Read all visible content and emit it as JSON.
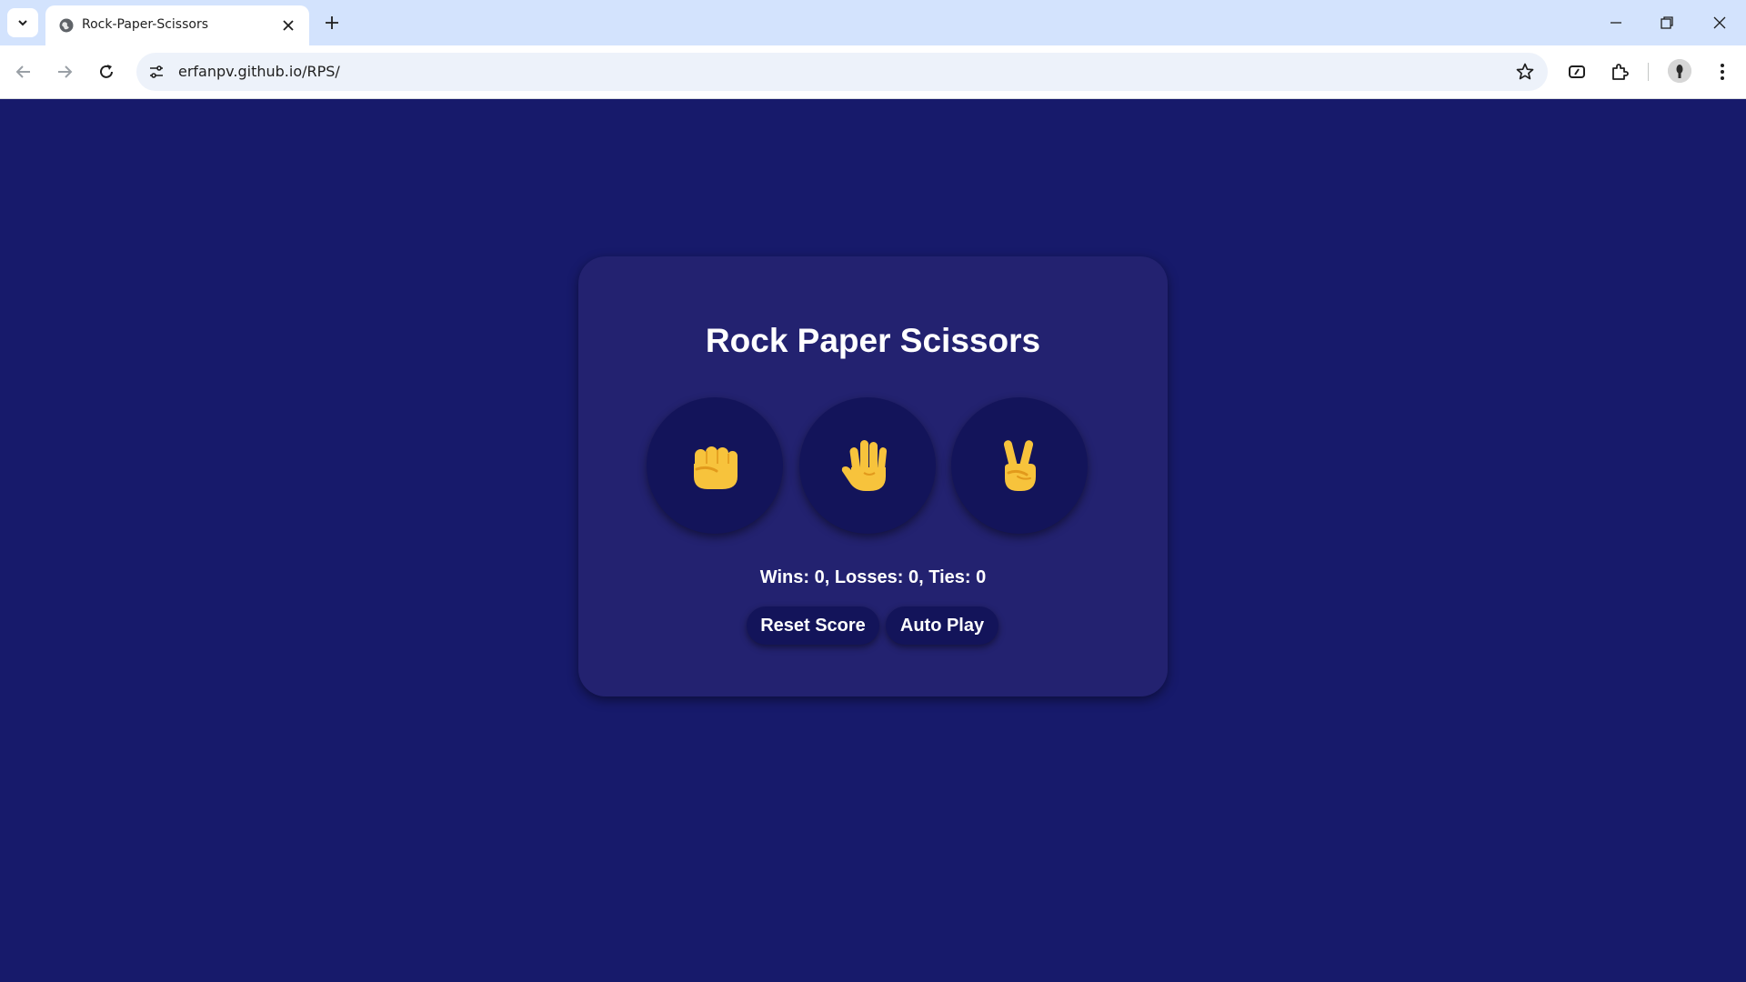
{
  "browser": {
    "tab_title": "Rock-Paper-Scissors",
    "url": "erfanpv.github.io/RPS/"
  },
  "game": {
    "title": "Rock Paper Scissors",
    "moves": [
      {
        "name": "rock",
        "icon": "raised-fist-emoji"
      },
      {
        "name": "paper",
        "icon": "raised-hand-emoji"
      },
      {
        "name": "scissors",
        "icon": "victory-hand-emoji"
      }
    ],
    "score_text": "Wins: 0, Losses: 0, Ties: 0",
    "reset_label": "Reset Score",
    "autoplay_label": "Auto Play"
  },
  "colors": {
    "page_background": "#171a6b",
    "card_background": "#232270",
    "button_background": "#13145a",
    "emoji_skin": "#f7c33c"
  }
}
